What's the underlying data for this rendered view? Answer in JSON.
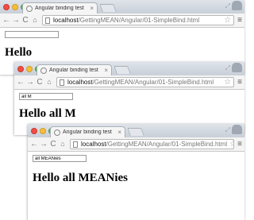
{
  "windows": [
    {
      "tab_title": "Angular binding test",
      "url_host": "localhost",
      "url_path": "/GettingMEAN/Angular/01-SimpleBind.html",
      "input_value": "",
      "heading": "Hello"
    },
    {
      "tab_title": "Angular binding test",
      "url_host": "localhost",
      "url_path": "/GettingMEAN/Angular/01-SimpleBind.html",
      "input_value": "all M",
      "heading": "Hello all M"
    },
    {
      "tab_title": "Angular binding test",
      "url_host": "localhost",
      "url_path": "/GettingMEAN/Angular/01-SimpleBind.html",
      "input_value": "all MEANies",
      "heading": "Hello all MEANies"
    }
  ],
  "icons": {
    "back": "back-arrow-icon",
    "forward": "forward-arrow-icon",
    "reload": "reload-icon",
    "home": "home-icon",
    "star": "bookmark-star-icon",
    "menu": "hamburger-menu-icon"
  },
  "colors": {
    "titlebar": "#c8cfd8",
    "close_light": "#f24c43",
    "minimize_light": "#f7be3a",
    "maximize_light": "#4fc254"
  }
}
